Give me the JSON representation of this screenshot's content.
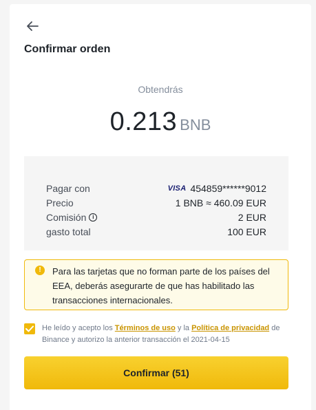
{
  "header": {
    "title": "Confirmar orden"
  },
  "receive": {
    "label": "Obtendrás",
    "amount": "0.213",
    "unit": "BNB"
  },
  "details": {
    "pay_with_label": "Pagar con",
    "card_brand": "VISA",
    "card_number": "454859******9012",
    "price_label": "Precio",
    "price_value": "1 BNB ≈ 460.09 EUR",
    "fee_label": "Comisión",
    "fee_value": "2 EUR",
    "total_label": "gasto total",
    "total_value": "100 EUR"
  },
  "warning": {
    "text": "Para las tarjetas que no forman parte de los países del EEA, deberás asegurarte de que has habilitado las transacciones internacionales."
  },
  "terms": {
    "checked": true,
    "prefix": "He leído y acepto los ",
    "terms_link": "Términos de uso",
    "middle": " y la ",
    "privacy_link": "Política de privacidad",
    "suffix": " de Binance y autorizo la anterior transacción el 2021-04-15"
  },
  "confirm_button": {
    "label": "Confirmar (51)"
  },
  "colors": {
    "accent": "#f0b90b",
    "link": "#c99400",
    "warning_bg": "#fefbe8"
  }
}
